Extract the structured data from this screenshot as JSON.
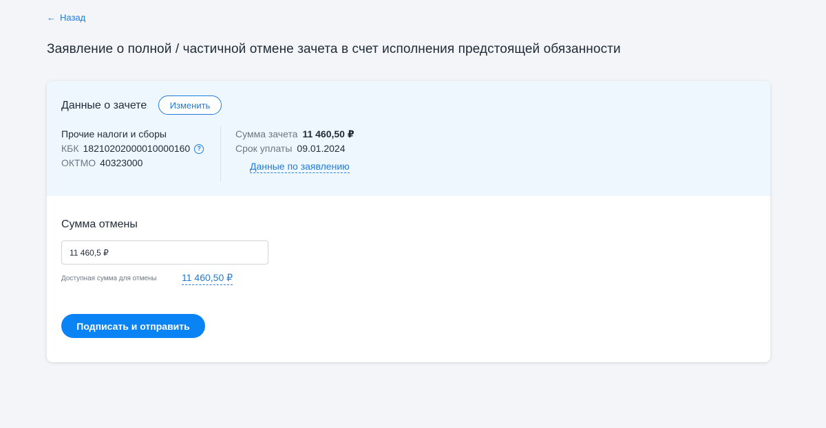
{
  "nav": {
    "back_label": "Назад"
  },
  "page": {
    "title": "Заявление о полной / частичной отмене зачета в счет исполнения предстоящей обязанности"
  },
  "offset": {
    "section_title": "Данные о зачете",
    "edit_label": "Изменить",
    "tax_name": "Прочие налоги и сборы",
    "kbk_label": "КБК",
    "kbk_value": "18210202000010000160",
    "oktmo_label": "ОКТМО",
    "oktmo_value": "40323000",
    "sum_label": "Сумма зачета",
    "sum_value": "11 460,50 ₽",
    "due_label": "Срок уплаты",
    "due_value": "09.01.2024",
    "app_data_link": "Данные по заявлению"
  },
  "cancel": {
    "title": "Сумма отмены",
    "input_value": "11 460,5 ₽",
    "available_label": "Доступная сумма для отмены",
    "available_value": "11 460,50 ₽",
    "submit_label": "Подписать и отправить"
  },
  "icons": {
    "back": "arrow-left-icon",
    "help": "question-circle-icon"
  },
  "colors": {
    "accent": "#1f7ad8",
    "primary_button": "#0a84f5",
    "background": "#f3f5f9",
    "info_panel": "#eef7fd"
  }
}
